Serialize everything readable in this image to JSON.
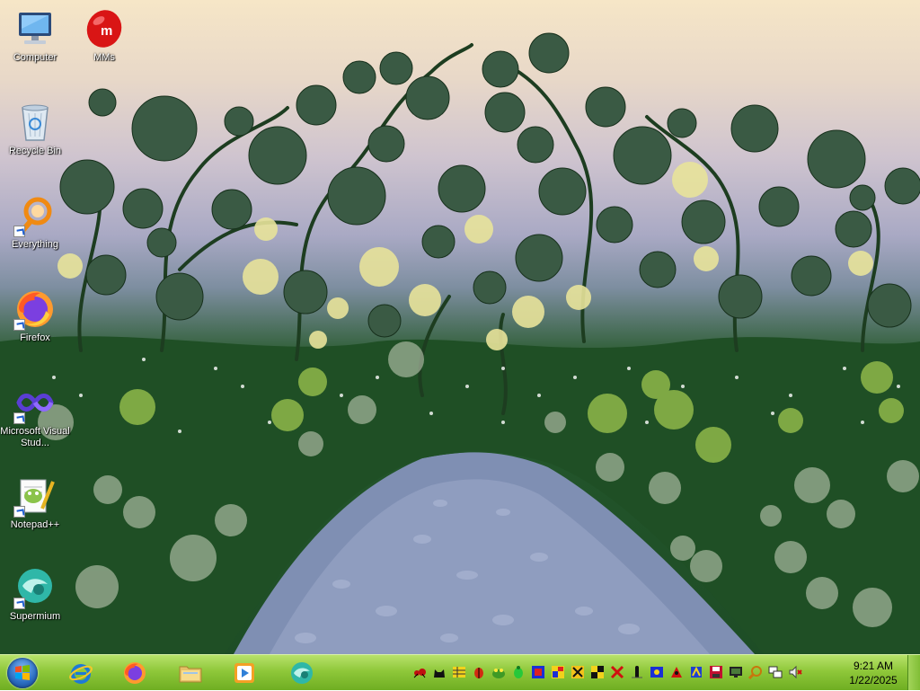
{
  "desktop": {
    "icons": [
      {
        "label": "Computer",
        "icon": "computer-icon"
      },
      {
        "label": "MMs",
        "icon": "mms-icon"
      },
      {
        "label": "Recycle Bin",
        "icon": "recycle-bin-icon"
      },
      {
        "label": "Everything",
        "icon": "everything-icon"
      },
      {
        "label": "Firefox",
        "icon": "firefox-icon"
      },
      {
        "label": "Microsoft Visual Stud...",
        "icon": "visual-studio-icon"
      },
      {
        "label": "Notepad++",
        "icon": "notepadplusplus-icon"
      },
      {
        "label": "Supermium",
        "icon": "supermium-icon"
      }
    ]
  },
  "taskbar": {
    "start": {
      "icon": "windows-start-icon"
    },
    "pinned": [
      {
        "name": "Internet Explorer",
        "icon": "internet-explorer-icon"
      },
      {
        "name": "Firefox",
        "icon": "firefox-icon"
      },
      {
        "name": "File Explorer",
        "icon": "folder-icon"
      },
      {
        "name": "Media Player",
        "icon": "media-player-icon"
      },
      {
        "name": "Supermium",
        "icon": "supermium-icon"
      }
    ],
    "tray_icons": [
      "red-ant-icon",
      "black-cat-icon",
      "yellow-grid-icon",
      "red-bug-icon",
      "frog-icon",
      "green-bug-icon",
      "blue-square-icon",
      "color-square-icon",
      "yellow-pattern-icon",
      "checker-icon",
      "red-x-icon",
      "black-figure-icon",
      "blue-figure-icon",
      "red-figure-icon",
      "blue-figure2-icon",
      "save-icon",
      "monitor-icon",
      "magnifier-icon",
      "network-icon",
      "speaker-muted-icon"
    ],
    "clock": {
      "time": "9:21 AM",
      "date": "1/22/2025"
    }
  },
  "colors": {
    "taskbar_top": "#b8e26b",
    "taskbar_bottom": "#6fae22",
    "accent": "#2d6fc3"
  }
}
